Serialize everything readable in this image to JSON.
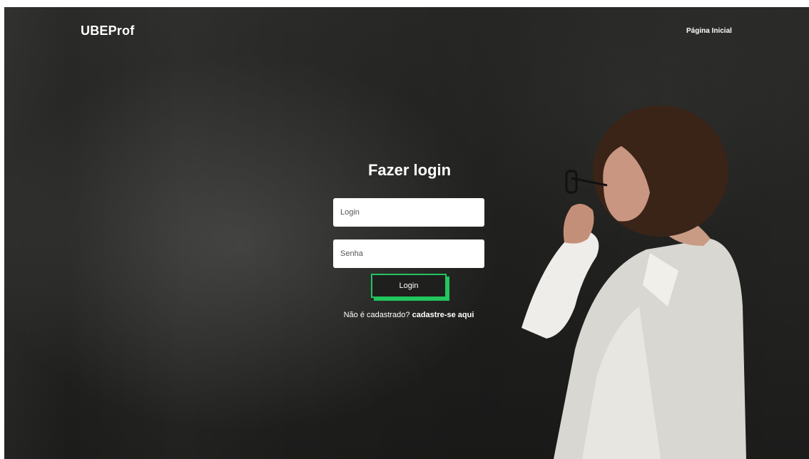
{
  "header": {
    "brand": "UBEProf",
    "nav_home": "Página Inicial"
  },
  "login_form": {
    "title": "Fazer login",
    "login_placeholder": "Login",
    "password_placeholder": "Senha",
    "submit_label": "Login",
    "signup_prompt": "Não é cadastrado?",
    "signup_link": "cadastre-se aqui"
  },
  "colors": {
    "accent": "#22c55e",
    "background": "#232321"
  }
}
